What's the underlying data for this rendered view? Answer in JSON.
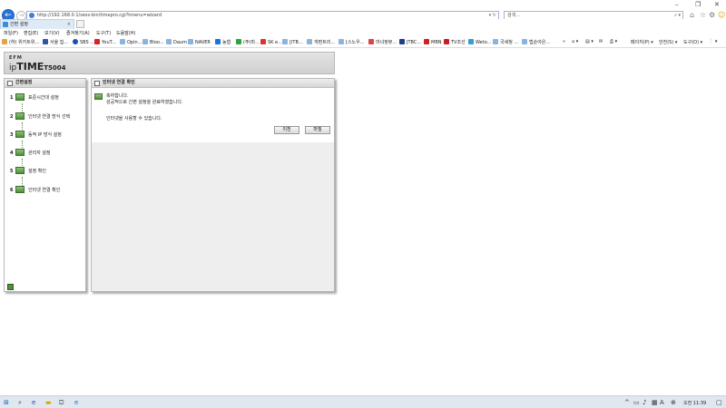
{
  "browser": {
    "url": "http://192.168.0.1/sess-bin/timepro.cgi?tmenu=wizard",
    "search_placeholder": "검색...",
    "tab_title": "간편 설정",
    "menu": [
      "파일(F)",
      "편집(E)",
      "보기(V)",
      "즐겨찾기(A)",
      "도구(T)",
      "도움말(H)"
    ],
    "favorites": [
      "(하) 위키트위...",
      "서울 집...",
      "SBS ...",
      "YouT...",
      "Opin...",
      "Bloo...",
      "Daum",
      "NAVER",
      "농협",
      "(주)마...",
      "SK e...",
      "[ITB...",
      "개편트리...",
      "[스노우...",
      "마녀정뷰...",
      "JTBC...",
      "MBN",
      "TV조선",
      "Weto...",
      "국세청 ...",
      "법순아은..."
    ],
    "tools": [
      "페이지(P) ▾",
      "안전(S) ▾",
      "도구(O) ▾"
    ]
  },
  "router": {
    "logo_top": "EFM",
    "brand_ip": "ip",
    "brand_time": "TIME",
    "model": "T5004"
  },
  "sidebar": {
    "title": "간편설정",
    "steps": [
      {
        "num": "1",
        "label": "표준시간대 설정"
      },
      {
        "num": "2",
        "label": "인터넷 연결 방식 선택"
      },
      {
        "num": "3",
        "label": "동적 IP 방식 설정"
      },
      {
        "num": "4",
        "label": "관리자 설정"
      },
      {
        "num": "5",
        "label": "설정 확인"
      },
      {
        "num": "6",
        "label": "인터넷 연결 확인"
      }
    ]
  },
  "main": {
    "title": "인터넷 연결 확인",
    "congrats": "축하합니다.",
    "message1": "성공적으로 간편 설정을 완료하였습니다.",
    "message2": "인터넷을 사용할 수 있습니다.",
    "prev_label": "이전",
    "finish_label": "마침"
  },
  "taskbar": {
    "time": "오전 11:39"
  }
}
